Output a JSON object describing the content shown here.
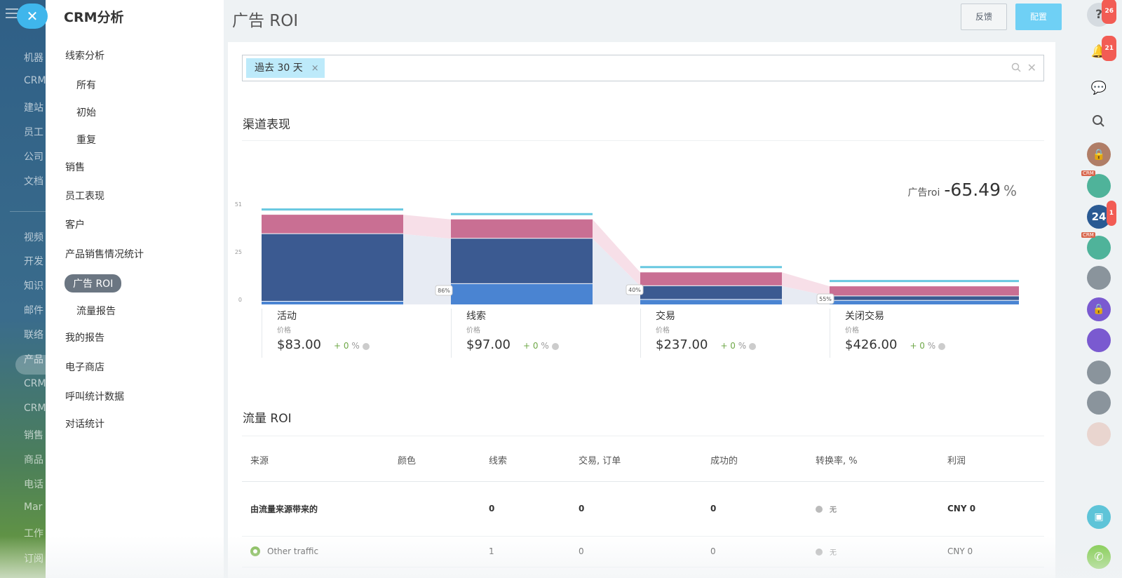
{
  "bg_nav": {
    "items": [
      "机器",
      "CRM",
      "建站",
      "员工",
      "公司",
      "文档",
      "视频",
      "开发",
      "知识",
      "邮件",
      "联络",
      "产品",
      "CRM",
      "CRM",
      "销售",
      "商品",
      "电话",
      "Mar",
      "工作",
      "订阅"
    ]
  },
  "report_menu": {
    "title": "CRM分析",
    "items": {
      "leads": "线索分析",
      "all": "所有",
      "initial": "初始",
      "repeat": "重复",
      "sales": "销售",
      "employee": "员工表现",
      "customers": "客户",
      "product_stats": "产品销售情况统计",
      "ad_roi": "广告 ROI",
      "traffic_report": "流量报告",
      "my_reports": "我的报告",
      "eshop": "电子商店",
      "call_stats": "呼叫统计数据",
      "chat_stats": "对话统计"
    }
  },
  "header": {
    "title": "广告 ROI",
    "feedback_label": "反馈",
    "config_label": "配置"
  },
  "filter": {
    "tag": "過去 30 天",
    "tag_close": "×",
    "clear": "✕"
  },
  "channel_section": {
    "title": "渠道表现",
    "roi_label": "广告roi",
    "roi_value": "-65.49",
    "roi_unit": "%"
  },
  "funnel": {
    "y_ticks": [
      "51",
      "25",
      "0"
    ],
    "stages": [
      {
        "name": "活动",
        "price_label": "价格",
        "amount": "$83.00",
        "delta": "+ 0",
        "pct": "%",
        "segments": {
          "top": 10,
          "mid": 36,
          "bottom": 1.5
        }
      },
      {
        "name": "线索",
        "price_label": "价格",
        "amount": "$97.00",
        "delta": "+ 0",
        "pct": "%",
        "segments": {
          "top": 10,
          "mid": 24,
          "bottom": 11
        }
      },
      {
        "name": "交易",
        "price_label": "价格",
        "amount": "$237.00",
        "delta": "+ 0",
        "pct": "%",
        "segments": {
          "top": 7,
          "mid": 7,
          "bottom": 2.5
        }
      },
      {
        "name": "关闭交易",
        "price_label": "价格",
        "amount": "$426.00",
        "delta": "+ 0",
        "pct": "%",
        "segments": {
          "top": 5,
          "mid": 2,
          "bottom": 2
        }
      }
    ],
    "conversions": [
      "86%",
      "40%",
      "55%"
    ]
  },
  "traffic_section": {
    "title": "流量 ROI",
    "columns": [
      "来源",
      "颜色",
      "线索",
      "交易, 订单",
      "成功的",
      "转换率, %",
      "利润"
    ],
    "rows": [
      {
        "source": "由流量来源带来的",
        "leads": "0",
        "deals": "0",
        "success": "0",
        "rate": "无",
        "profit": "CNY 0"
      },
      {
        "source": "Other traffic",
        "leads": "1",
        "deals": "0",
        "success": "0",
        "rate": "无",
        "profit": "CNY 0"
      }
    ]
  },
  "right_bar": {
    "help_badge": "26",
    "notif_badge": "21",
    "b24_label": "24",
    "b24_badge": "1",
    "crm_tag": "CRM"
  },
  "colors": {
    "pink": "#c96f93",
    "navy": "#3b5a91",
    "blue": "#4a84d2",
    "cyan": "#67c8e0",
    "accent": "#3fb6ec"
  }
}
